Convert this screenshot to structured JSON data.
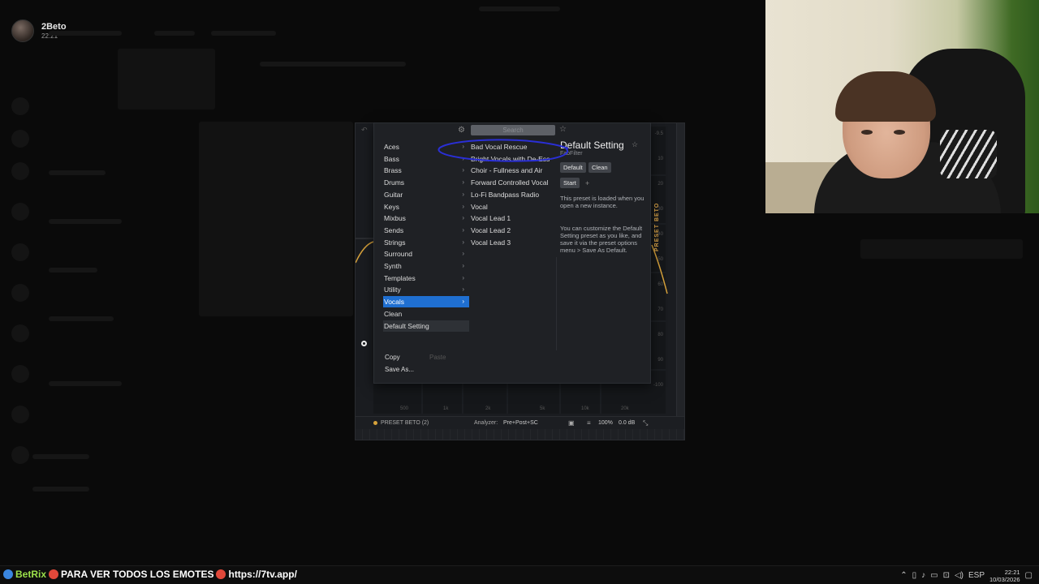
{
  "background_app": {
    "user_name": "2Beto",
    "user_time": "22:21"
  },
  "plugin": {
    "status": {
      "preset": "PRESET BETO (2)",
      "analyzer_label": "Analyzer:",
      "analyzer_value": "Pre+Post+SC",
      "zoom": "100%",
      "gain": "0.0 dB"
    },
    "side_label": "PRESET BETO",
    "freq_labels": [
      "500",
      "1k",
      "2k",
      "5k",
      "10k",
      "20k"
    ],
    "db_labels": [
      "-9.5",
      "10",
      "20",
      "30",
      "40",
      "50",
      "60",
      "70",
      "80",
      "90",
      "-100"
    ]
  },
  "preset_browser": {
    "search_placeholder": "Search",
    "categories": [
      {
        "label": "Aces",
        "submenu": true
      },
      {
        "label": "Bass",
        "submenu": true
      },
      {
        "label": "Brass",
        "submenu": true
      },
      {
        "label": "Drums",
        "submenu": true
      },
      {
        "label": "Guitar",
        "submenu": true
      },
      {
        "label": "Keys",
        "submenu": true
      },
      {
        "label": "Mixbus",
        "submenu": true
      },
      {
        "label": "Sends",
        "submenu": true
      },
      {
        "label": "Strings",
        "submenu": true
      },
      {
        "label": "Surround",
        "submenu": true
      },
      {
        "label": "Synth",
        "submenu": true
      },
      {
        "label": "Templates",
        "submenu": true
      },
      {
        "label": "Utility",
        "submenu": true
      },
      {
        "label": "Vocals",
        "submenu": true,
        "selected": true
      },
      {
        "label": "Clean",
        "submenu": false
      },
      {
        "label": "Default Setting",
        "submenu": false,
        "highlighted": true
      }
    ],
    "presets": [
      "Bad Vocal Rescue",
      "Bright Vocals with De-Ess",
      "Choir - Fullness and Air",
      "Forward Controlled Vocal",
      "Lo-Fi Bandpass Radio",
      "Vocal",
      "Vocal Lead 1",
      "Vocal Lead 2",
      "Vocal Lead 3"
    ],
    "info": {
      "title": "Default Setting",
      "vendor": "FabFilter",
      "tags": [
        "Default",
        "Clean",
        "Start"
      ],
      "description_1": "This preset is loaded when you open a new instance.",
      "description_2": "You can customize the Default Setting preset as you like, and save it via the preset options menu > Save As Default."
    },
    "actions": {
      "copy": "Copy",
      "paste": "Paste",
      "save_as": "Save As..."
    }
  },
  "taskbar": {
    "ticker_name": "BetRix",
    "ticker_text": "PARA VER TODOS LOS EMOTES",
    "ticker_url": "https://7tv.app/",
    "language": "ESP",
    "time": "22:21",
    "date": "10/03/2026"
  },
  "colors": {
    "selection": "#1f6fd1",
    "eq_curve": "#d7a23b",
    "annotation": "#2a2fd6"
  }
}
